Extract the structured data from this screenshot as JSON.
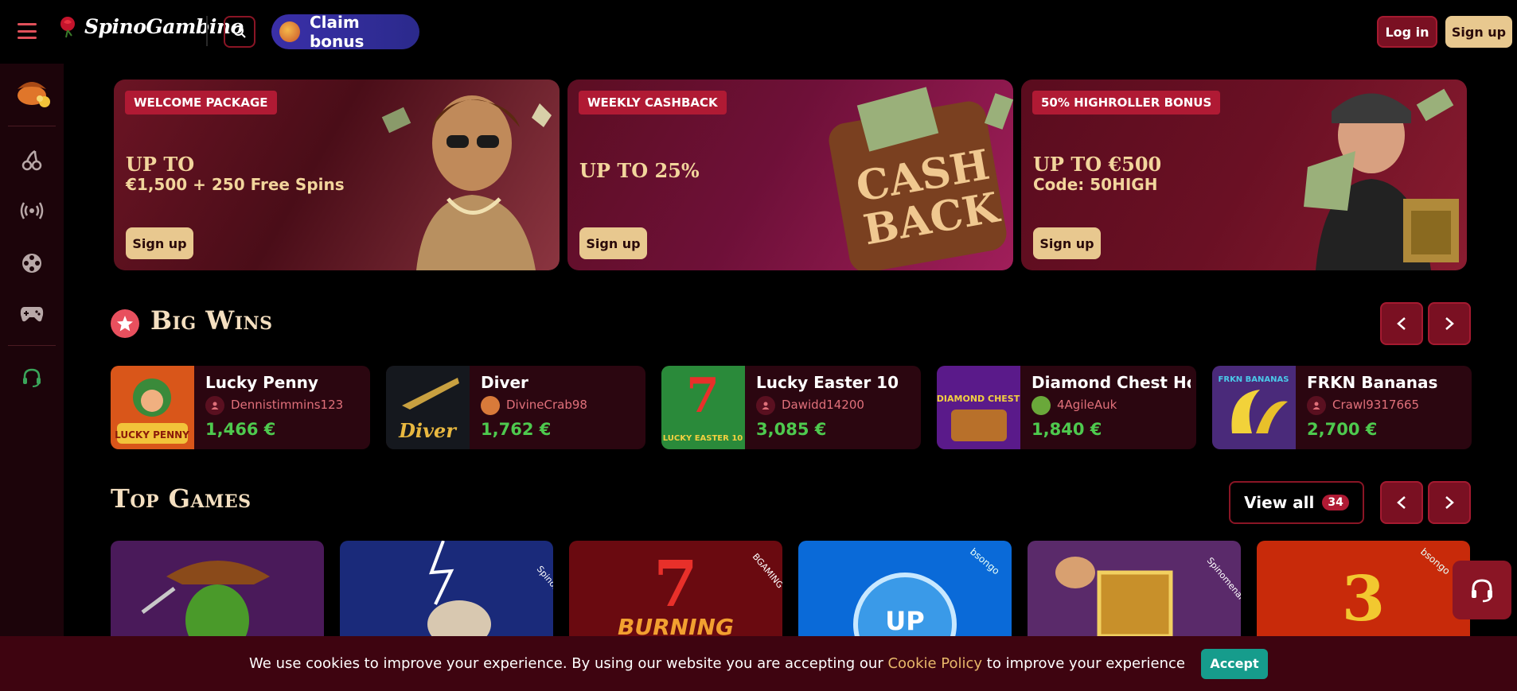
{
  "header": {
    "logo_text": "SpinoGambino",
    "claim_label": "Claim bonus",
    "login_label": "Log in",
    "signup_label": "Sign up"
  },
  "sidebar": {
    "items": [
      {
        "icon": "pirate-treasure-icon"
      },
      {
        "icon": "cherry-icon"
      },
      {
        "icon": "live-broadcast-icon"
      },
      {
        "icon": "film-reel-icon"
      },
      {
        "icon": "gamepad-icon"
      },
      {
        "icon": "headset-icon"
      }
    ]
  },
  "promos": [
    {
      "badge": "WELCOME PACKAGE",
      "title": "UP TO",
      "subtitle": "€1,500 + 250 Free Spins",
      "button": "Sign up"
    },
    {
      "badge": "WEEKLY CASHBACK",
      "title": "UP TO 25%",
      "subtitle": "",
      "button": "Sign up",
      "art_text_1": "CASH",
      "art_text_2": "BACK"
    },
    {
      "badge": "50% HIGHROLLER BONUS",
      "title": "UP TO €500",
      "subtitle": "Code: 50HIGH",
      "button": "Sign up"
    }
  ],
  "big_wins": {
    "title": "Big Wins",
    "items": [
      {
        "game": "Lucky Penny",
        "user": "Dennistimmins123",
        "amount": "1,466 €",
        "thumb_text": "LUCKY PENNY"
      },
      {
        "game": "Diver",
        "user": "DivineCrab98",
        "amount": "1,762 €",
        "thumb_text": "Diver"
      },
      {
        "game": "Lucky Easter 10",
        "user": "Dawidd14200",
        "amount": "3,085 €",
        "thumb_text": "LUCKY EASTER 10"
      },
      {
        "game": "Diamond Chest Hold 'N",
        "user": "4AgileAuk",
        "amount": "1,840 €",
        "thumb_text": "DIAMOND CHEST"
      },
      {
        "game": "FRKN Bananas",
        "user": "Crawl9317665",
        "amount": "2,700 €",
        "thumb_text": "FRKN BANANAS"
      }
    ]
  },
  "top_games": {
    "title": "Top Games",
    "view_all_label": "View all",
    "count": "34",
    "tiles": [
      {
        "name": "cowboy-pepper-game",
        "provider": ""
      },
      {
        "name": "zeus-game",
        "provider": "Spinomenal"
      },
      {
        "name": "burning-sevens-game",
        "provider": "BGAMING",
        "text": "BURNING"
      },
      {
        "name": "up-coin-game",
        "provider": "bsongo",
        "text": "UP"
      },
      {
        "name": "golden-mirror-game",
        "provider": "Spinomenal"
      },
      {
        "name": "three-coin-game",
        "provider": "bsongo",
        "text": "3"
      }
    ]
  },
  "cookie": {
    "text_before": "We use cookies to improve your experience. By using our website you are accepting our ",
    "link": "Cookie Policy",
    "text_after": " to improve your experience",
    "accept_label": "Accept"
  },
  "colors": {
    "accent_red": "#8a1525",
    "gold_button": "#e8c88f",
    "win_green": "#4ec94e",
    "accept_teal": "#169c8c"
  }
}
